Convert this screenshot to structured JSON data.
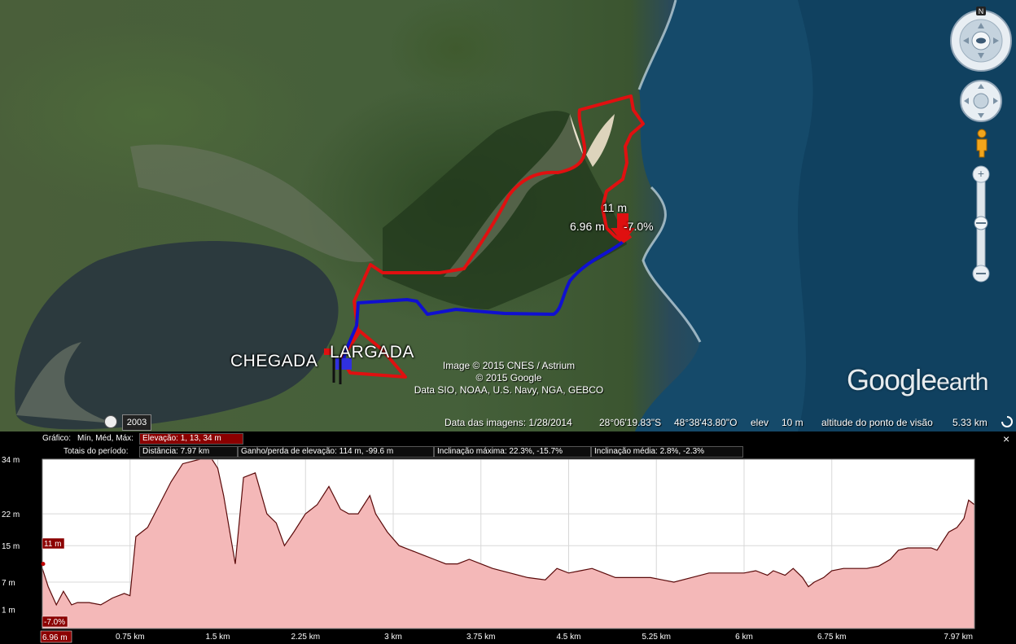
{
  "map": {
    "labels": {
      "finish": "CHEGADA",
      "start": "LARGADA",
      "marker_elev": "11 m",
      "marker_dist": "6.96 m",
      "marker_slope": "-7.0%"
    },
    "copyright_lines": [
      "Image © 2015 CNES / Astrium",
      "© 2015 Google",
      "Data SIO, NOAA, U.S. Navy, NGA, GEBCO"
    ],
    "logo_main": "Google",
    "logo_suffix": "earth",
    "year_badge": "2003",
    "compass_north": "N",
    "status": {
      "imagery_date_label": "Data das imagens: 1/28/2014",
      "lat": "28°06'19.83\"S",
      "lon": "48°38'43.80\"O",
      "elev_label": "elev",
      "elev_value": "10 m",
      "eye_alt_label": "altitude do ponto de visão",
      "eye_alt_value": "5.33 km"
    },
    "colors": {
      "route_red": "#e01010",
      "route_blue": "#1010d0",
      "sea": "#154a6a"
    },
    "icons": [
      "compass-icon",
      "look-joystick-icon",
      "move-joystick-icon",
      "street-view-pegman-icon",
      "zoom-in-icon",
      "zoom-out-icon",
      "clock-icon",
      "loading-spinner-icon"
    ]
  },
  "panel": {
    "row1": {
      "graph_label": "Gráfico:",
      "min_mid_max": "Mín, Méd, Máx:",
      "elevation": "Elevação: 1, 13, 34 m"
    },
    "row2": {
      "totals_label": "Totais do período:",
      "distance": "Distância: 7.97 km",
      "gain_loss": "Ganho/perda de elevação: 114 m, -99.6 m",
      "max_slope": "Inclinação máxima: 22.3%, -15.7%",
      "avg_slope": "Inclinação média: 2.8%, -2.3%"
    },
    "close": "×",
    "cursor_elev": "11 m",
    "cursor_slope": "-7.0%",
    "cursor_dist": "6.96 m"
  },
  "chart_data": {
    "type": "area",
    "title": "",
    "xlabel": "",
    "ylabel": "",
    "ylim": [
      -3.2,
      34
    ],
    "xlim": [
      0,
      7.97
    ],
    "y_ticks": [
      {
        "value": 34,
        "label": "34 m"
      },
      {
        "value": 22,
        "label": "22 m"
      },
      {
        "value": 15,
        "label": "15 m"
      },
      {
        "value": 7,
        "label": "7 m"
      },
      {
        "value": 1,
        "label": "1 m"
      }
    ],
    "x_ticks": [
      {
        "value": 0.75,
        "label": "0.75 km"
      },
      {
        "value": 1.5,
        "label": "1.5 km"
      },
      {
        "value": 2.25,
        "label": "2.25 km"
      },
      {
        "value": 3,
        "label": "3 km"
      },
      {
        "value": 3.75,
        "label": "3.75 km"
      },
      {
        "value": 4.5,
        "label": "4.5 km"
      },
      {
        "value": 5.25,
        "label": "5.25 km"
      },
      {
        "value": 6,
        "label": "6 km"
      },
      {
        "value": 6.75,
        "label": "6.75 km"
      },
      {
        "value": 7.97,
        "label": "7.97 km"
      }
    ],
    "grid": true,
    "fill_color": "#f4b8b8",
    "line_color": "#5a0a0a",
    "series": [
      {
        "x": [
          0,
          0.05,
          0.12,
          0.18,
          0.25,
          0.3,
          0.4,
          0.5,
          0.6,
          0.7,
          0.75,
          0.8,
          0.9,
          1.0,
          1.1,
          1.2,
          1.35,
          1.45,
          1.5,
          1.55,
          1.65,
          1.72,
          1.82,
          1.92,
          2.0,
          2.07,
          2.15,
          2.25,
          2.35,
          2.45,
          2.55,
          2.62,
          2.7,
          2.8,
          2.85,
          2.95,
          3.05,
          3.15,
          3.25,
          3.35,
          3.45,
          3.55,
          3.65,
          3.75,
          3.85,
          4.0,
          4.15,
          4.3,
          4.4,
          4.5,
          4.6,
          4.7,
          4.8,
          4.9,
          5.0,
          5.1,
          5.2,
          5.3,
          5.4,
          5.55,
          5.7,
          5.85,
          6.0,
          6.1,
          6.2,
          6.25,
          6.35,
          6.42,
          6.5,
          6.55,
          6.6,
          6.68,
          6.75,
          6.85,
          6.95,
          7.05,
          7.15,
          7.25,
          7.32,
          7.4,
          7.5,
          7.6,
          7.65,
          7.75,
          7.82,
          7.88,
          7.92,
          7.97
        ],
        "y": [
          10,
          6,
          2,
          5,
          2,
          2.5,
          2.5,
          2,
          3.5,
          4.5,
          4,
          17,
          19,
          24,
          29,
          33,
          35,
          34,
          32,
          26,
          11,
          30,
          31,
          22,
          20,
          15,
          18,
          22,
          24,
          28,
          23,
          22,
          22,
          26,
          22,
          18,
          15,
          14,
          13,
          12,
          11,
          11,
          12,
          11,
          10,
          9,
          8,
          7.5,
          10,
          9,
          9.5,
          10,
          9,
          8,
          8,
          8,
          8,
          7.5,
          7,
          8,
          9,
          9,
          9,
          9.5,
          8.5,
          9.5,
          8.5,
          10,
          8,
          6,
          7,
          8,
          9.5,
          10,
          10,
          10,
          10.5,
          12,
          14,
          14.5,
          14.5,
          14.5,
          14,
          18,
          19,
          21,
          25,
          24
        ]
      }
    ],
    "cursor": {
      "x": 0.0,
      "y": 11
    }
  }
}
